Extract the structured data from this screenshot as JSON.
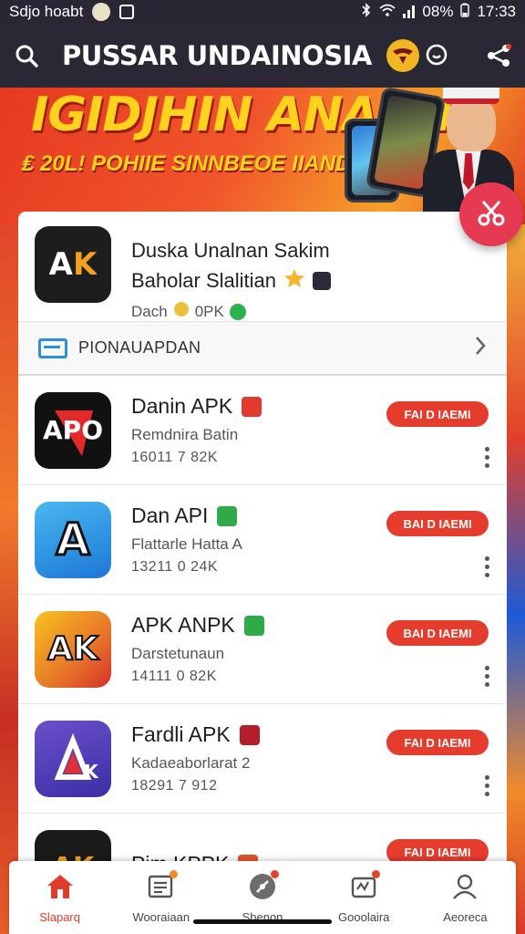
{
  "status_bar": {
    "left_text": "Sdjo hoabt",
    "battery": "08%",
    "time": "17:33"
  },
  "app_bar": {
    "title": "PUSSAR UNDAINOSIA",
    "icons": [
      "search-icon",
      "emblem-icon",
      "chat-icon",
      "share-icon"
    ]
  },
  "banner": {
    "title": "IGIDJHIN ANAANA",
    "subtitle": "₤ 20L! POHIIE SINNBEOE IIANDASIS"
  },
  "featured": {
    "icon_text": "AK",
    "line1": "Duska Unalnan Sakim",
    "line2": "Baholar Slalitian",
    "meta": "Dach",
    "size": "0PK"
  },
  "section": {
    "label": "PIONAUAPDAN"
  },
  "apps": [
    {
      "name": "Danin APK",
      "sub": "Remdnira Batin",
      "size": "16011 7 82K",
      "button": "FAI D IAEMI",
      "icon_text": "APO",
      "badge_color": "#e23a2c"
    },
    {
      "name": "Dan API",
      "sub": "Flattarle Hatta A",
      "size": "13211 0 24K",
      "button": "BAI D IAEMI",
      "icon_text": "A",
      "badge_color": "#2faa48"
    },
    {
      "name": "APK ANPK",
      "sub": "Darstetunaun",
      "size": "14111 0 82K",
      "button": "BAI D IAEMI",
      "icon_text": "AK",
      "badge_color": "#2faa48"
    },
    {
      "name": "Fardli APK",
      "sub": "Kadaeaborlarat 2",
      "size": "18291 7 912",
      "button": "FAI D IAEMI",
      "icon_text": "K",
      "badge_color": "#b31e2a"
    },
    {
      "name": "Pim KPPK",
      "sub": "",
      "size": "",
      "button": "FAI D IAEMI",
      "icon_text": "AK",
      "badge_color": "#e8512b"
    }
  ],
  "bottom_nav": [
    {
      "label": "Slaparq",
      "icon": "home-icon",
      "active": true
    },
    {
      "label": "Wooraiaan",
      "icon": "news-icon",
      "active": false
    },
    {
      "label": "Shenon",
      "icon": "explore-icon",
      "active": false
    },
    {
      "label": "Gooolaira",
      "icon": "apps-icon",
      "active": false
    },
    {
      "label": "Aeoreca",
      "icon": "profile-icon",
      "active": false
    }
  ]
}
